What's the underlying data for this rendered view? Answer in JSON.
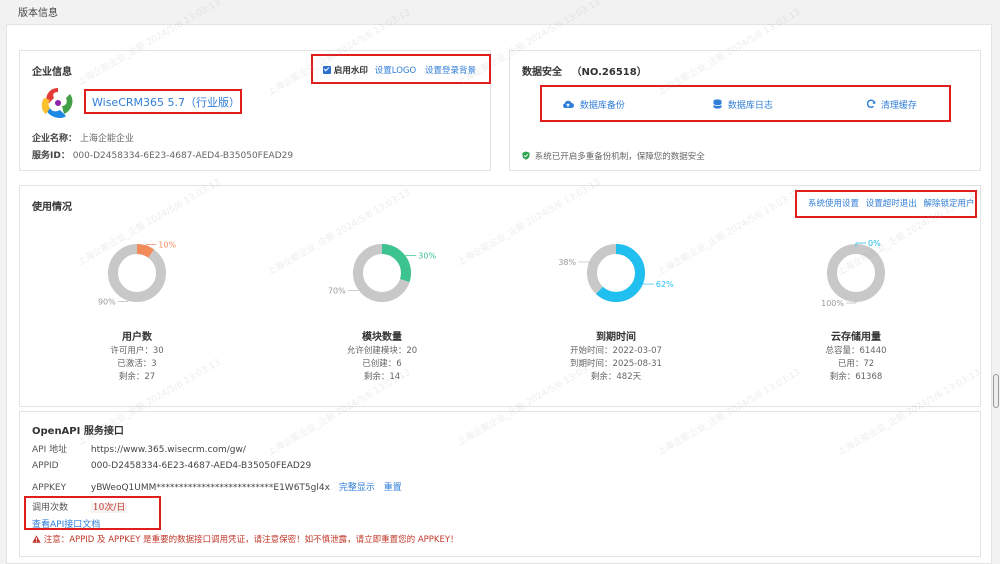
{
  "page": {
    "title": "版本信息"
  },
  "company": {
    "header": "企业信息",
    "watermark_label": "启用水印",
    "watermark_checked": true,
    "set_logo": "设置LOGO",
    "set_login_bg": "设置登录背景",
    "product": "WiseCRM365 5.7（行业版）",
    "name_label": "企业名称：",
    "name_value": "上海企能企业",
    "service_label": "服务ID：",
    "service_value": "000-D2458334-6E23-4687-AED4-B35050FEAD29"
  },
  "security": {
    "header": "数据安全",
    "code": "（NO.26518）",
    "backup": "数据库备份",
    "log": "数据库日志",
    "clear_cache": "清理缓存",
    "note": "系统已开启多重备份机制，保障您的数据安全"
  },
  "usage": {
    "header": "使用情况",
    "links": [
      "系统使用设置",
      "设置超时退出",
      "解除锁定用户"
    ],
    "stats": [
      {
        "title": "用户数",
        "percent_used": 10,
        "used_label": "10%",
        "rest_label": "90%",
        "color": "#f28b5a",
        "lines": [
          "许可用户：30",
          "已激活：3",
          "剩余：27"
        ]
      },
      {
        "title": "模块数量",
        "percent_used": 30,
        "used_label": "30%",
        "rest_label": "70%",
        "color": "#3cc38f",
        "lines": [
          "允许创建模块：20",
          "已创建：6",
          "剩余：14"
        ]
      },
      {
        "title": "到期时间",
        "percent_used": 62,
        "used_label": "62%",
        "rest_label": "38%",
        "color": "#1fbff0",
        "lines": [
          "开始时间：2022-03-07",
          "到期时间：2025-08-31",
          "剩余：482天"
        ]
      },
      {
        "title": "云存储用量",
        "percent_used": 0,
        "used_label": "0%",
        "rest_label": "100%",
        "color": "#1fbff0",
        "lines": [
          "总容量：61440",
          "已用：72",
          "剩余：61368"
        ]
      }
    ]
  },
  "openapi": {
    "header": "OpenAPI 服务接口",
    "api_label": "API 地址",
    "api_value": "https://www.365.wisecrm.com/gw/",
    "appid_label": "APPID",
    "appid_value": "000-D2458334-6E23-4687-AED4-B35050FEAD29",
    "appkey_label": "APPKEY",
    "appkey_value": "yBWeoQ1UMM**************************E1W6T5gl4x",
    "show_full": "完整显示",
    "reset": "重置",
    "calls_label": "调用次数",
    "calls_value": "10次/日",
    "doc_link": "查看API接口文档",
    "warning": "注意：APPID 及 APPKEY 是重要的数据接口调用凭证，请注意保密！如不慎泄露，请立即重置您的 APPKEY！"
  },
  "watermark_text": "上海企能企业_企能  2024/5/6 13:03:13"
}
